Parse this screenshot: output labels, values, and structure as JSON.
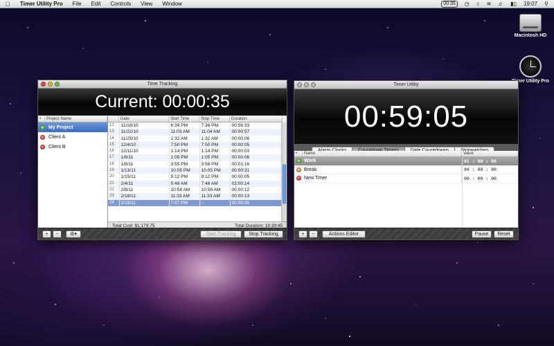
{
  "menubar": {
    "app_name": "Timer Utility Pro",
    "items": [
      "File",
      "Edit",
      "Controls",
      "View",
      "Window"
    ],
    "timer_badge": "00:35",
    "clock": "19:07"
  },
  "desktop": {
    "hd_label": "Macintosh HD",
    "app_label": "Timer Utility Pro"
  },
  "time_tracking": {
    "title": "Time Tracking",
    "current": "Current: 00:00:35",
    "project_header": "Project Name",
    "projects": [
      {
        "name": "My Project",
        "status": "green"
      },
      {
        "name": "Client A",
        "status": "red"
      },
      {
        "name": "Client B",
        "status": "red"
      }
    ],
    "columns": [
      "Date",
      "Start Time",
      "Stop Time",
      "Duration"
    ],
    "rows": [
      {
        "n": "12",
        "date": "11/18/10",
        "start": "6:39 PM",
        "stop": "7:36 PM",
        "dur": "00:56:33"
      },
      {
        "n": "13",
        "date": "11/22/10",
        "start": "11:03 AM",
        "stop": "11:04 AM",
        "dur": "00:00:57"
      },
      {
        "n": "14",
        "date": "11/25/10",
        "start": "1:32 AM",
        "stop": "1:32 AM",
        "dur": "00:00:06"
      },
      {
        "n": "15",
        "date": "12/4/10",
        "start": "7:50 PM",
        "stop": "7:50 PM",
        "dur": "00:00:05"
      },
      {
        "n": "16",
        "date": "12/11/10",
        "start": "1:14 PM",
        "stop": "1:14 PM",
        "dur": "00:00:03"
      },
      {
        "n": "17",
        "date": "1/8/11",
        "start": "1:05 PM",
        "stop": "1:05 PM",
        "dur": "00:00:06"
      },
      {
        "n": "18",
        "date": "1/8/11",
        "start": "3:55 PM",
        "stop": "3:56 PM",
        "dur": "00:01:16"
      },
      {
        "n": "19",
        "date": "1/13/11",
        "start": "10:05 PM",
        "stop": "10:05 PM",
        "dur": "00:00:31"
      },
      {
        "n": "20",
        "date": "1/15/11",
        "start": "9:12 PM",
        "stop": "9:12 PM",
        "dur": "00:00:05"
      },
      {
        "n": "21",
        "date": "2/4/11",
        "start": "5:48 AM",
        "stop": "7:48 AM",
        "dur": "02:00:14"
      },
      {
        "n": "22",
        "date": "2/8/11",
        "start": "10:58 AM",
        "stop": "10:58 AM",
        "dur": "00:00:12"
      },
      {
        "n": "23",
        "date": "2/18/11",
        "start": "11:33 AM",
        "stop": "11:33 AM",
        "dur": "00:00:13"
      },
      {
        "n": "24",
        "date": "2/18/11",
        "start": "7:07 PM",
        "stop": "--",
        "dur": "00:00:35"
      }
    ],
    "total_cost": "Total Cost:  $1,179.75",
    "total_duration": "Total Duration:  19:39:45",
    "add_label": "+",
    "remove_label": "−",
    "gear_label": "⚙▾",
    "start_tracking": "Start Tracking",
    "stop_tracking": "Stop Tracking"
  },
  "timer_utility": {
    "title": "Timer Utility",
    "display": "00:59:05",
    "tabs": [
      "Alarm Clocks",
      "Countdown Timers",
      "Date Countdowns",
      "Stopwatches"
    ],
    "active_tab": "Countdown Timers",
    "columns": [
      "Name",
      "Value"
    ],
    "timers": [
      {
        "name": "Work",
        "value": "01 : 00 : 00",
        "status": "green"
      },
      {
        "name": "Break",
        "value": "00 : 00 : 00",
        "status": "orange"
      },
      {
        "name": "New Timer",
        "value": "00 : 00 : 00",
        "status": "red"
      }
    ],
    "add_label": "+",
    "remove_label": "−",
    "actions_editor": "Actions Editor",
    "pause": "Pause",
    "reset": "Reset"
  }
}
